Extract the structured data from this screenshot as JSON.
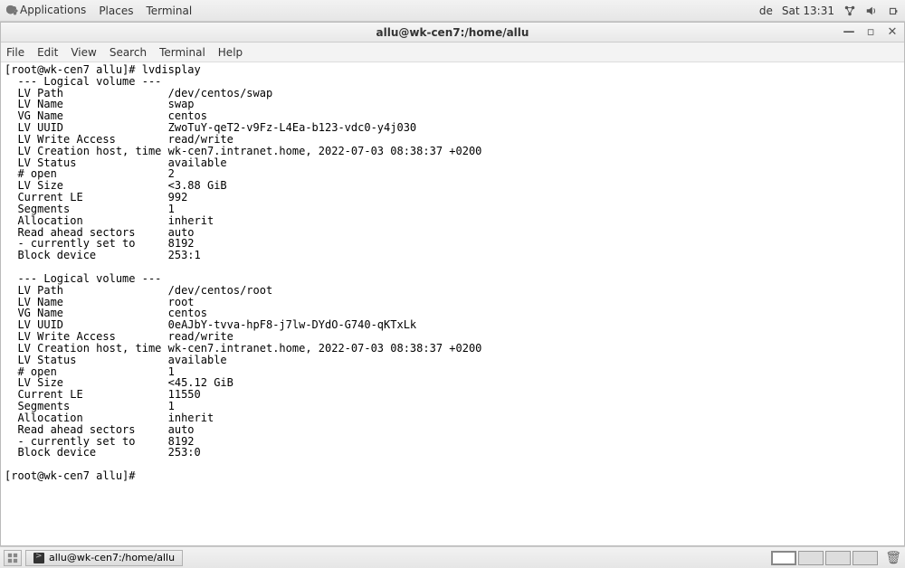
{
  "panel": {
    "apps": "Applications",
    "places": "Places",
    "terminal": "Terminal",
    "lang": "de",
    "clock": "Sat 13:31"
  },
  "window": {
    "title": "allu@wk-cen7:/home/allu"
  },
  "menubar": {
    "file": "File",
    "edit": "Edit",
    "view": "View",
    "search": "Search",
    "terminal": "Terminal",
    "help": "Help"
  },
  "terminal": {
    "prompt1": "[root@wk-cen7 allu]# ",
    "cmd1": "lvdisplay",
    "lines": [
      "  --- Logical volume ---",
      "  LV Path                /dev/centos/swap",
      "  LV Name                swap",
      "  VG Name                centos",
      "  LV UUID                ZwoTuY-qeT2-v9Fz-L4Ea-b123-vdc0-y4j030",
      "  LV Write Access        read/write",
      "  LV Creation host, time wk-cen7.intranet.home, 2022-07-03 08:38:37 +0200",
      "  LV Status              available",
      "  # open                 2",
      "  LV Size                <3.88 GiB",
      "  Current LE             992",
      "  Segments               1",
      "  Allocation             inherit",
      "  Read ahead sectors     auto",
      "  - currently set to     8192",
      "  Block device           253:1",
      "",
      "  --- Logical volume ---",
      "  LV Path                /dev/centos/root",
      "  LV Name                root",
      "  VG Name                centos",
      "  LV UUID                0eAJbY-tvva-hpF8-j7lw-DYdO-G740-qKTxLk",
      "  LV Write Access        read/write",
      "  LV Creation host, time wk-cen7.intranet.home, 2022-07-03 08:38:37 +0200",
      "  LV Status              available",
      "  # open                 1",
      "  LV Size                <45.12 GiB",
      "  Current LE             11550",
      "  Segments               1",
      "  Allocation             inherit",
      "  Read ahead sectors     auto",
      "  - currently set to     8192",
      "  Block device           253:0",
      ""
    ],
    "prompt2": "[root@wk-cen7 allu]# "
  },
  "taskbar": {
    "task1": "allu@wk-cen7:/home/allu"
  }
}
